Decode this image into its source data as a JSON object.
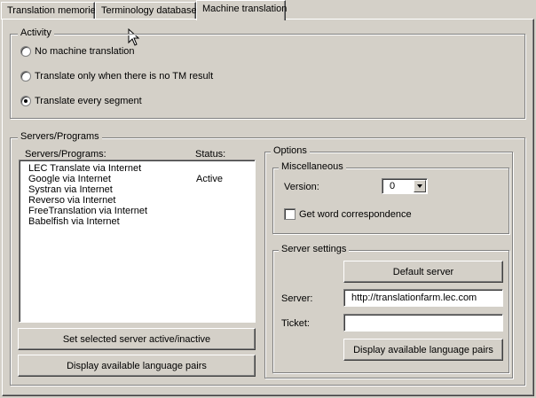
{
  "tabs": [
    {
      "label": "Translation memories"
    },
    {
      "label": "Terminology databases"
    },
    {
      "label": "Machine translation"
    }
  ],
  "activity": {
    "title": "Activity",
    "options": [
      {
        "label": "No machine translation",
        "checked": false
      },
      {
        "label": "Translate only when there is no TM result",
        "checked": false
      },
      {
        "label": "Translate every segment",
        "checked": true
      }
    ]
  },
  "servers": {
    "title": "Servers/Programs",
    "col_name": "Servers/Programs:",
    "col_status": "Status:",
    "items": [
      {
        "name": "LEC Translate via Internet",
        "status": ""
      },
      {
        "name": "Google via Internet",
        "status": "Active"
      },
      {
        "name": "Systran via Internet",
        "status": ""
      },
      {
        "name": "Reverso via Internet",
        "status": ""
      },
      {
        "name": "FreeTranslation via Internet",
        "status": ""
      },
      {
        "name": "Babelfish via Internet",
        "status": ""
      }
    ],
    "set_active_button": "Set selected server active/inactive",
    "display_pairs_button": "Display available language pairs"
  },
  "options": {
    "title": "Options",
    "misc": {
      "title": "Miscellaneous",
      "version_label": "Version:",
      "version_value": "0",
      "word_correspondence_label": "Get word correspondence",
      "word_correspondence_checked": false
    },
    "server_settings": {
      "title": "Server settings",
      "default_server_button": "Default server",
      "server_label": "Server:",
      "server_value": "http://translationfarm.lec.com",
      "ticket_label": "Ticket:",
      "ticket_value": "",
      "display_pairs_button": "Display available language pairs"
    }
  },
  "icons": {
    "cursor": "mouse-pointer-icon"
  }
}
